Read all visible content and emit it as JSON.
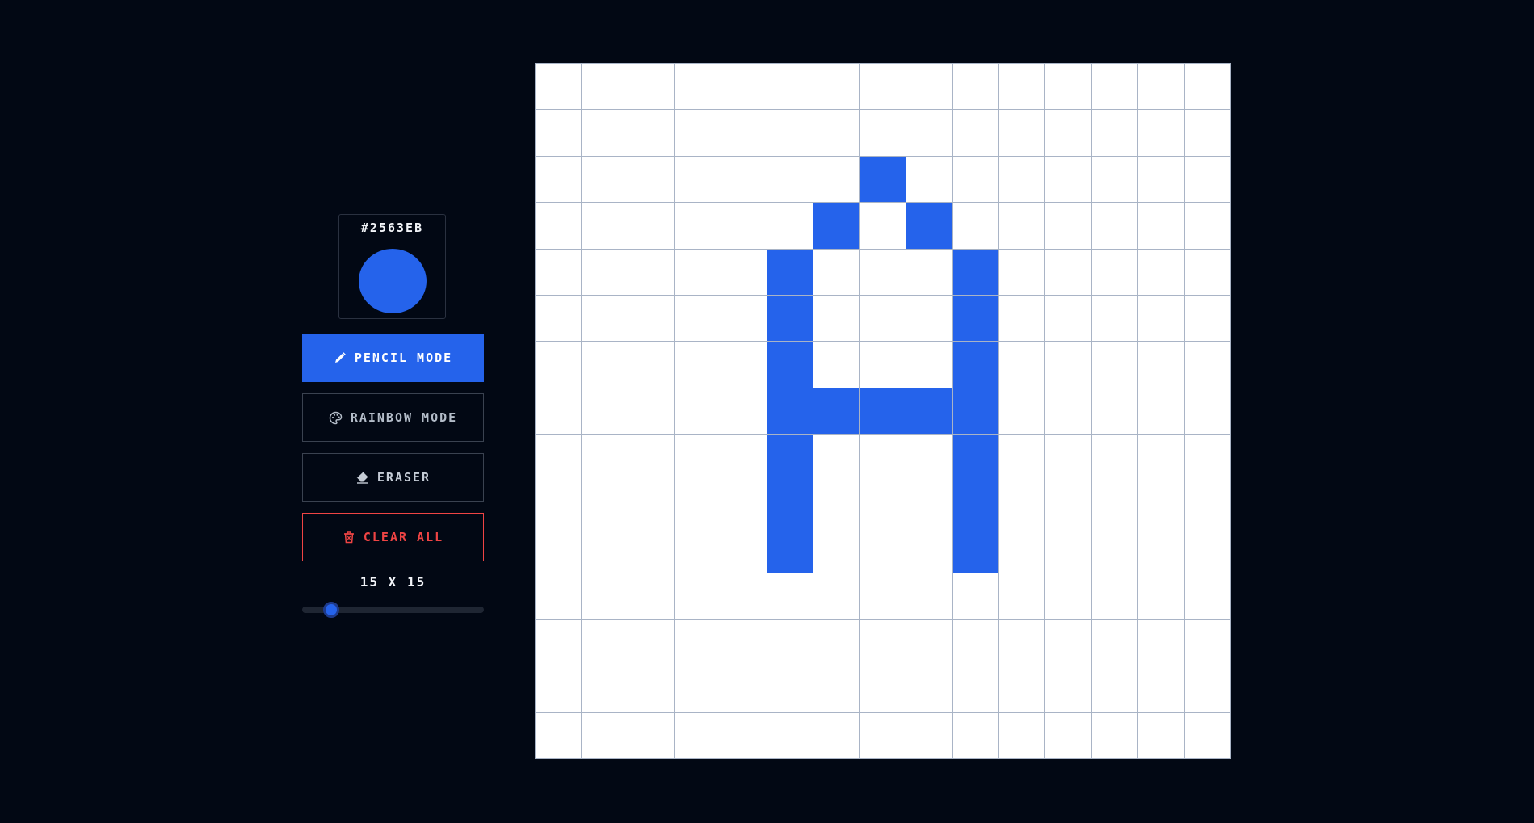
{
  "colors": {
    "accent": "#2563EB",
    "danger": "#EF4444",
    "cell_empty": "#FFFFFF"
  },
  "color_picker": {
    "hex": "#2563EB",
    "swatch_color": "#2563EB"
  },
  "tools": {
    "pencil_label": "PENCIL MODE",
    "pencil_icon": "pencil-icon",
    "rainbow_label": "RAINBOW MODE",
    "rainbow_icon": "palette-icon",
    "eraser_label": "ERASER",
    "eraser_icon": "eraser-icon",
    "clear_label": "CLEAR ALL",
    "clear_icon": "trash-icon",
    "active": "pencil"
  },
  "grid": {
    "size_label": "15 X 15",
    "rows": 15,
    "cols": 15,
    "slider_min": 8,
    "slider_max": 64,
    "slider_value": 15,
    "filled": [
      [
        2,
        7
      ],
      [
        3,
        6
      ],
      [
        3,
        8
      ],
      [
        4,
        5
      ],
      [
        4,
        9
      ],
      [
        5,
        5
      ],
      [
        5,
        9
      ],
      [
        6,
        5
      ],
      [
        6,
        9
      ],
      [
        7,
        5
      ],
      [
        7,
        6
      ],
      [
        7,
        7
      ],
      [
        7,
        8
      ],
      [
        7,
        9
      ],
      [
        8,
        5
      ],
      [
        8,
        9
      ],
      [
        9,
        5
      ],
      [
        9,
        9
      ],
      [
        10,
        5
      ],
      [
        10,
        9
      ]
    ]
  }
}
